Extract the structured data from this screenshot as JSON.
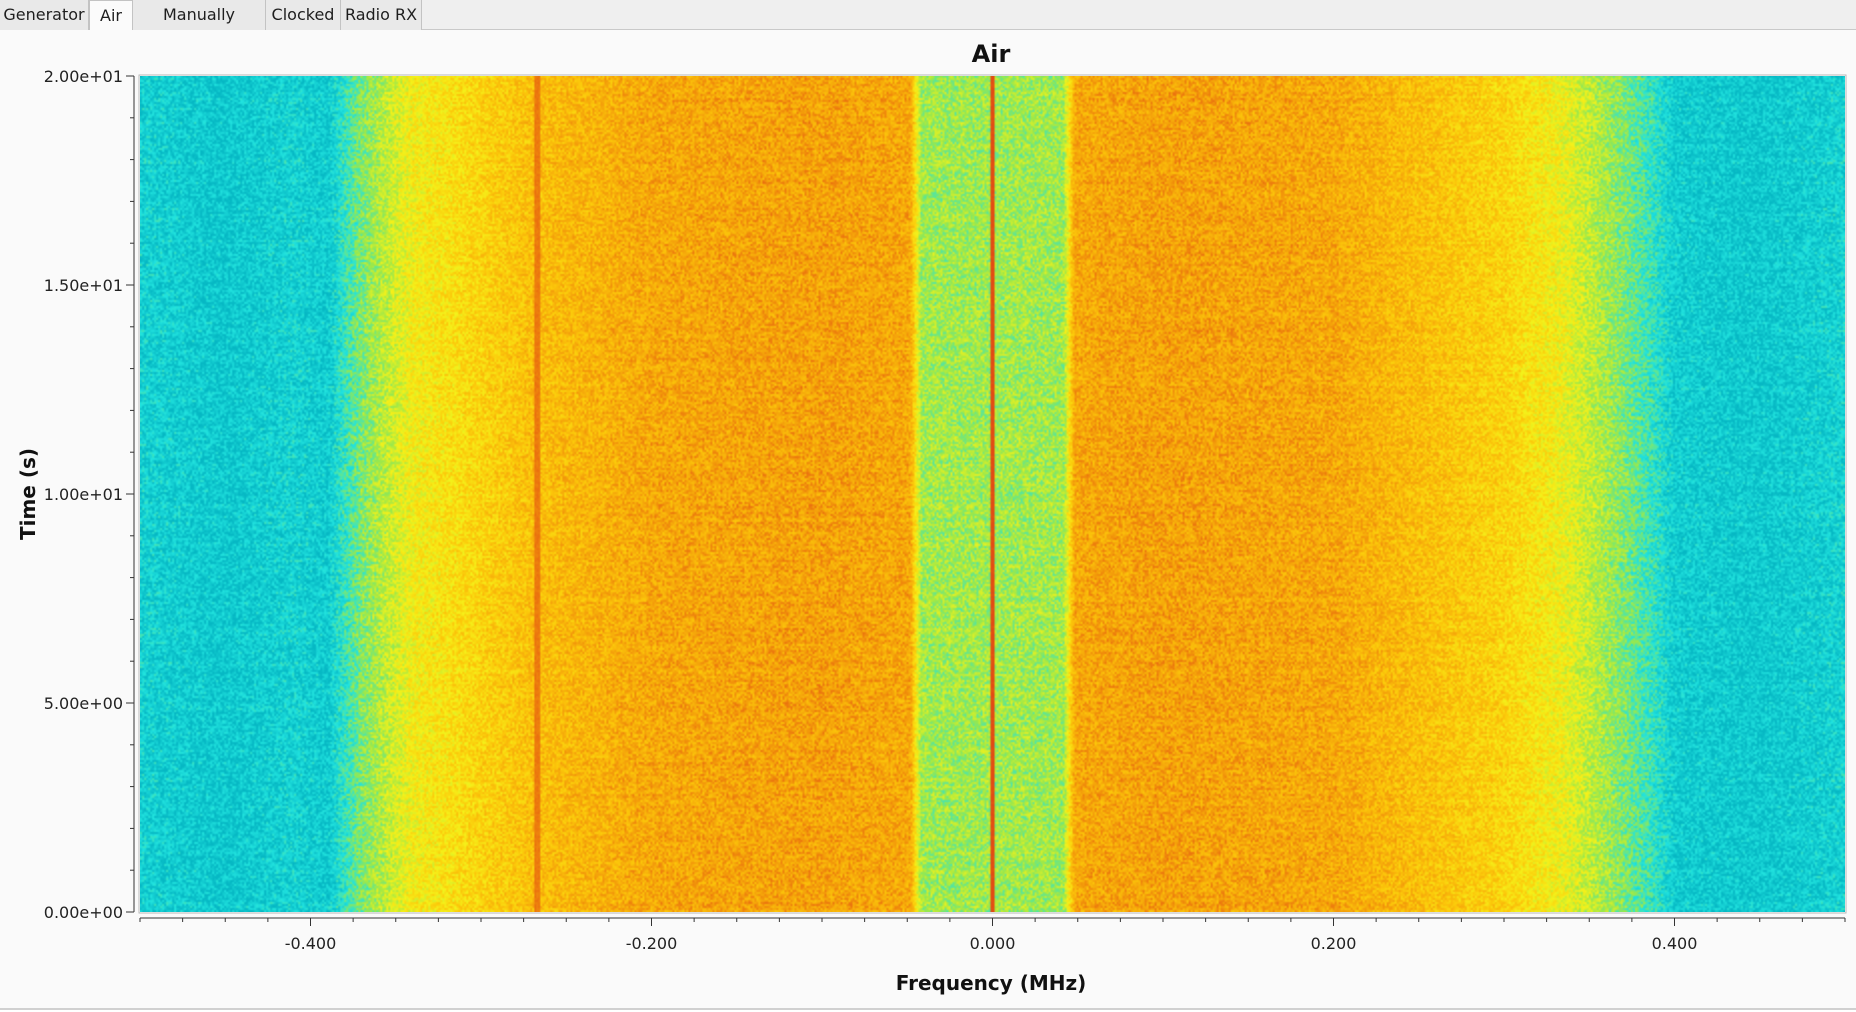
{
  "tabs": [
    {
      "label": "Generator",
      "active": false
    },
    {
      "label": "Air",
      "active": true
    },
    {
      "label": "Manually clocked",
      "active": false
    },
    {
      "label": "Clocked",
      "active": false
    },
    {
      "label": "Radio RX",
      "active": false
    }
  ],
  "chart_data": {
    "type": "heatmap",
    "title": "Air",
    "xlabel": "Frequency (MHz)",
    "ylabel": "Time (s)",
    "xlim": [
      -0.5,
      0.5
    ],
    "ylim": [
      0,
      20
    ],
    "x_ticks": [
      {
        "value": -0.4,
        "label": "-0.400"
      },
      {
        "value": -0.2,
        "label": "-0.200"
      },
      {
        "value": 0.0,
        "label": "0.000"
      },
      {
        "value": 0.2,
        "label": "0.200"
      },
      {
        "value": 0.4,
        "label": "0.400"
      }
    ],
    "y_ticks": [
      {
        "value": 0,
        "label": "0.00e+00"
      },
      {
        "value": 5,
        "label": "5.00e+00"
      },
      {
        "value": 10,
        "label": "1.00e+01"
      },
      {
        "value": 15,
        "label": "1.50e+01"
      },
      {
        "value": 20,
        "label": "2.00e+01"
      }
    ],
    "grid": false,
    "colormap": [
      "#06b8c4",
      "#21e3df",
      "#9be84a",
      "#f5f21a",
      "#fcc80a",
      "#f39a0a",
      "#e24a14"
    ],
    "spectral_profile": {
      "frequency_mhz": [
        -0.5,
        -0.45,
        -0.41,
        -0.39,
        -0.37,
        -0.34,
        -0.3,
        -0.27,
        -0.2,
        -0.1,
        -0.048,
        -0.042,
        0.0,
        0.042,
        0.048,
        0.1,
        0.2,
        0.3,
        0.33,
        0.37,
        0.385,
        0.4,
        0.45,
        0.5
      ],
      "relative_level": [
        0.1,
        0.06,
        0.1,
        0.07,
        0.3,
        0.52,
        0.62,
        0.7,
        0.78,
        0.8,
        0.78,
        0.35,
        0.35,
        0.35,
        0.78,
        0.8,
        0.78,
        0.62,
        0.52,
        0.3,
        0.2,
        0.08,
        0.06,
        0.1
      ]
    },
    "carriers": [
      {
        "frequency_mhz": 0.0,
        "relative_level": 1.0
      },
      {
        "frequency_mhz": -0.267,
        "relative_level": 0.9
      }
    ]
  }
}
